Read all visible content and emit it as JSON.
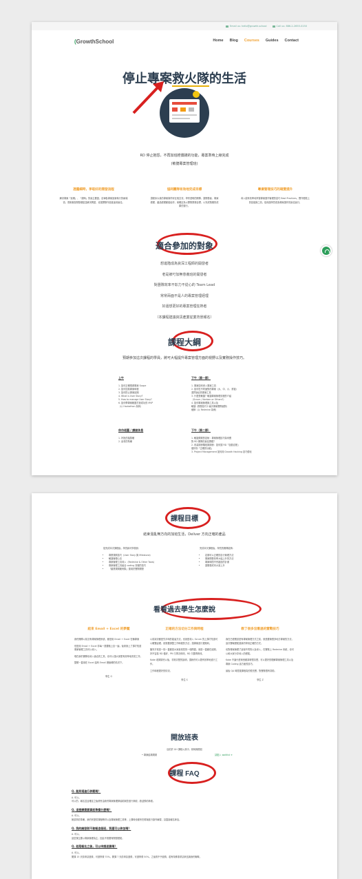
{
  "topbar": {
    "email": "Email us: hello@growth.school",
    "call": "Call us: 886-2-2655-0150"
  },
  "nav": {
    "logo": "GrowthSchool",
    "items": [
      "Home",
      "Blog",
      "Courses",
      "Guides",
      "Contact"
    ]
  },
  "hero": {
    "title_left": "停止專案",
    "title_mid": "救火隊",
    "title_right": "的生活",
    "desc": "RD 停止抱怨，不再加班趕價錢的功能，專案準時上線完成",
    "desc2": "(敏捷專案管理班)"
  },
  "features": [
    {
      "title": "透露細時，爭取好的開發流程",
      "text": "解決專案「延期」、「超時」的最主要因，自律各專案設置執行的兩端項，重新審查開發難點並解決問題，也讓實際作進度達到最佳。"
    },
    {
      "title": "協同團隊有效地完成目標",
      "text": "讓程序大量的專案與同伴互相交流，學會透明的團隊，讓開發者、專案經理、產品經理都能協作，而確定為以實際業務目標，以完成預期的成果的運行。"
    },
    {
      "title": "專業管理技巧的確實提升",
      "text": "導入能有效率地掌握專案運作管理的技巧 Best Practices，實作經驗上的技能與工具，從而讓學員成為專案運作的最佳窗口。"
    }
  ],
  "audience": {
    "title": "適合參加的對象",
    "items": [
      "想進階成為資深工程師的開發者",
      "老是被叮加無意義班的開發者",
      "對團隊效率不彰力不從心的 Team Lead",
      "常常兩面不是人的專案管理經理",
      "好還想更好的專案管理狂熱者",
      "（本課程建議資訊產業從業背景報名）"
    ]
  },
  "outline": {
    "title": "課程大綱",
    "intro": "預期參加這次課程的學員，將可大幅提升專案管理方面的視野以及實務操作技巧。",
    "blocks": [
      {
        "head": "上午",
        "lines": [
          "1. 如何正確規劃專案 Scope",
          "2. 如何控制專案時程",
          "3. 如何防止專案延期",
          "4. What is User Story?",
          "5. How to manage User Story?",
          "6. 如何帶專案範圍打造成功的 MVP",
          "   （以 Hackathon 為例）"
        ]
      },
      {
        "head": "下午（第一節）",
        "lines": [
          "1. 專案如何導入專案工具",
          "2. 如何在不同面對的專案（大、中、小、重複）",
          "   選擇適合的專案工具",
          "3. 什麼是敏捷？敏捷專案管理流程的介紹",
          "   （Scrum / Kanban or Others?）",
          "4. 如何專案管理與工具以及",
          "   敏捷（開發技巧十幾次專案實際面對）",
          "   細節（以 Redmine 為例）"
        ]
      },
      {
        "head": "休作佬圖 / 課間休息",
        "lines": [
          "1. 好批的抽獎暖",
          "2. 素材的準備"
        ]
      },
      {
        "head": "下午（第二節）",
        "lines": [
          "1. 敏捷規劃的技術：專案管理技巧為何應",
          "   對 RD 團隊的最佳實踐？",
          "2. 改善關係階段與關係：如何讓 RD「自動自發」",
          "   做好份「正確的功能」",
          "3. Project Management 如何用 Growth Hacking 技巧優化"
        ]
      }
    ]
  },
  "goals": {
    "title": "課程目標",
    "sub": "結束混亂無方向的加班生活，Deliver 方向正確的產品",
    "left_head": "從完成本次課程後，學員將可學習到：",
    "left": [
      "專業規劃技巧（User Story 與 Milestone）",
      "敏捷管理心法",
      "專案管理工具導入（Redmine & Other Tools）",
      "專案管理工具組合 coding 流程的技巧",
      "「產業規劃範例集」運用於實際開發"
    ],
    "right_head": "完成本次課程後，學員的團隊能夠：",
    "right": [
      "定期可以正確的自行管理方法",
      "專案開發效率大幅上升的方法",
      "專案時間不會超過的計畫",
      "讓開發成本大量上升"
    ]
  },
  "reviews": {
    "title": "看看過去學生怎麼說",
    "items": [
      {
        "title": "結束 Email + Excel 的夢魘",
        "text": [
          "我們團隊以前沒有專案管理系統，都是用 Email + Excel 在聯專案",
          "但是用 Email + Excel 非每一週要跑上百一遍，後來我上了課才知道專案管理工具可以導入。",
          "現在我們團隊也導入適合的工具，也可以讓大家更有效率地完成工作。",
          "整體一直用在 Excel 還有 Email 裡面轉的情況下。"
        ],
        "author": "學生 G"
      },
      {
        "title": "正確的方法切分工作與時程",
        "text": [
          "以前狀況都是先平時的能達方法，也就是導入 Scrum 的上課才知道可以確實處理，依需要調整工作時程的方法，讓專案進行更順利。",
          "聽完平常是一樣一直都是大家最常見的一個問題，就是一直都在延期，好不容易 RD 做好、PM 又再次修改，RD 又要再修改。",
          "Kobe 老師講完以後，非常清楚的說明，讓我們可以更有效率地進行工作。",
          "工作時程更好的情況。"
        ],
        "author": "學生 S"
      },
      {
        "title": "教了很多沒看過的實戰技巧",
        "text": [
          "我在已經應該是有專案管理方式之前，就是要管很多地方專案的方法，這次實戰經驗讓我們學到正確的方式。",
          "也對專案管理了這個不同的以及導入，在實務上 Redmine 系統，也可以和大家分享導入的經驗。",
          "Kobe 不論什麼東西都講得很清楚，可以更好的理解專案管理工具以及專案 Coding 這方面的技巧。",
          "最後 QA 時間讓課程真的很充實，對實務很有幫助。"
        ],
        "author": "學生 Z"
      }
    ]
  },
  "class": {
    "title": "開放班表",
    "status": "目前於 GH 課程火熱中，暫時無開班",
    "item": "•  專案結構規劃",
    "note": "請點入 waitlist ➜"
  },
  "faq": {
    "title": "課程 FAQ",
    "items": [
      {
        "q": "Q. 能到場進行參觀嗎？",
        "a": [
          "A. 可以。",
          "可以的，報名並且確定之後便會由我們專案管理師協助與您進行參觀，歡迎預約參觀。"
        ]
      },
      {
        "q": "Q. 這堂課需要事前準備什麼嗎？",
        "a": [
          "A. 可以。",
          "無須事前準備，我們會提供課程教材以及專案管理工具等，上課時也都會在現場進行操作練習，請直接報名參加。"
        ]
      },
      {
        "q": "Q. 我的開發對不敢報這個班，我還可以參加嗎？",
        "a": [
          "A. 可以。",
          "這堂課主要以專案管理為主，因此不需要有開發經驗。"
        ]
      },
      {
        "q": "Q. 若是報名之後，可以申請退費嗎？",
        "a": [
          "A. 可以。",
          "開課 15 天前申請退費，可退學費 70%。開課 7 天前申請退費，可退學費 50%。之後則不予退費，若有特殊需求請來信與我們聯繫。"
        ]
      }
    ]
  },
  "colors": {
    "orange": "#f0a030",
    "green": "#2e9e5b",
    "red": "#d8201f",
    "navy": "#2c3e50"
  }
}
